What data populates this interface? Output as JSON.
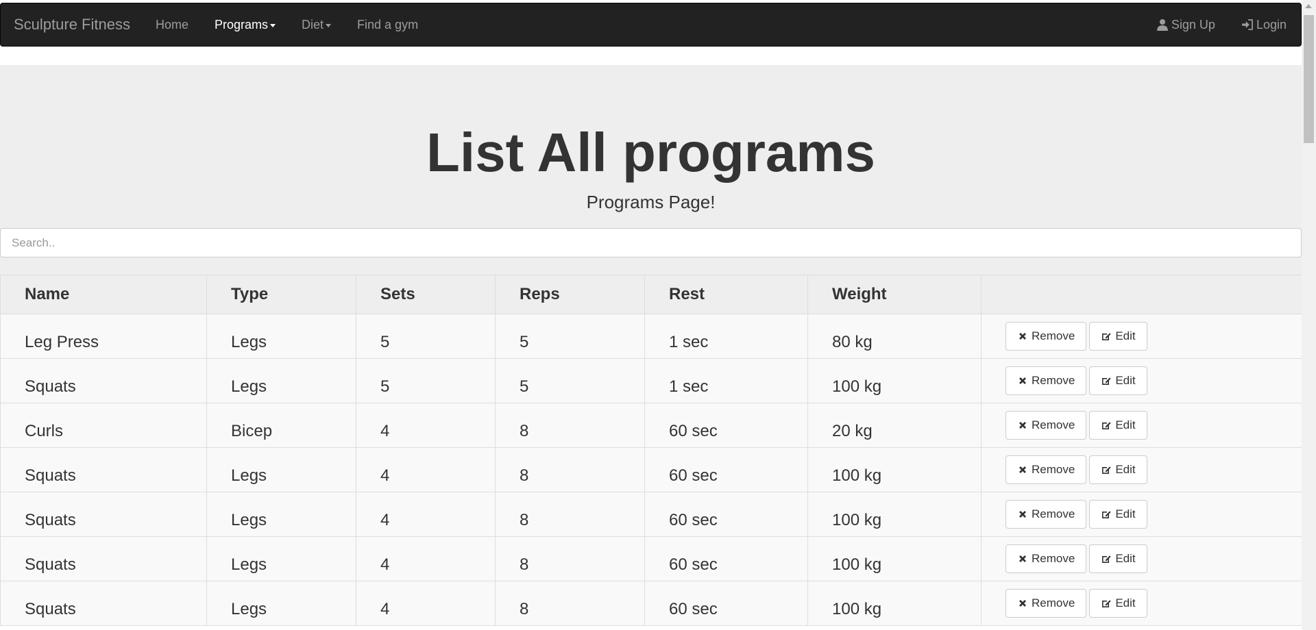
{
  "navbar": {
    "brand": "Sculpture Fitness",
    "links": [
      {
        "label": "Home"
      },
      {
        "label": "Programs",
        "active": true,
        "dropdown": true
      },
      {
        "label": "Diet",
        "dropdown": true
      },
      {
        "label": "Find a gym"
      }
    ],
    "right": {
      "signup": {
        "label": "Sign Up",
        "icon": "user-icon"
      },
      "login": {
        "label": "Login",
        "icon": "login-icon"
      }
    }
  },
  "hero": {
    "title": "List All programs",
    "subtitle": "Programs Page!"
  },
  "search": {
    "placeholder": "Search.."
  },
  "table": {
    "headers": [
      "Name",
      "Type",
      "Sets",
      "Reps",
      "Rest",
      "Weight"
    ],
    "rows": [
      [
        "Leg Press",
        "Legs",
        "5",
        "5",
        "1 sec",
        "80 kg"
      ],
      [
        "Squats",
        "Legs",
        "5",
        "5",
        "1 sec",
        "100 kg"
      ],
      [
        "Curls",
        "Bicep",
        "4",
        "8",
        "60 sec",
        "20 kg"
      ],
      [
        "Squats",
        "Legs",
        "4",
        "8",
        "60 sec",
        "100 kg"
      ],
      [
        "Squats",
        "Legs",
        "4",
        "8",
        "60 sec",
        "100 kg"
      ],
      [
        "Squats",
        "Legs",
        "4",
        "8",
        "60 sec",
        "100 kg"
      ],
      [
        "Squats",
        "Legs",
        "4",
        "8",
        "60 sec",
        "100 kg"
      ]
    ],
    "remove_label": "Remove",
    "edit_label": "Edit",
    "remove_icon": "remove-x-icon",
    "edit_icon": "edit-icon"
  },
  "colors": {
    "navbar_bg": "#222222",
    "nav_text": "#9d9d9d",
    "nav_active": "#ffffff",
    "jumbotron_bg": "#eeeeee"
  }
}
